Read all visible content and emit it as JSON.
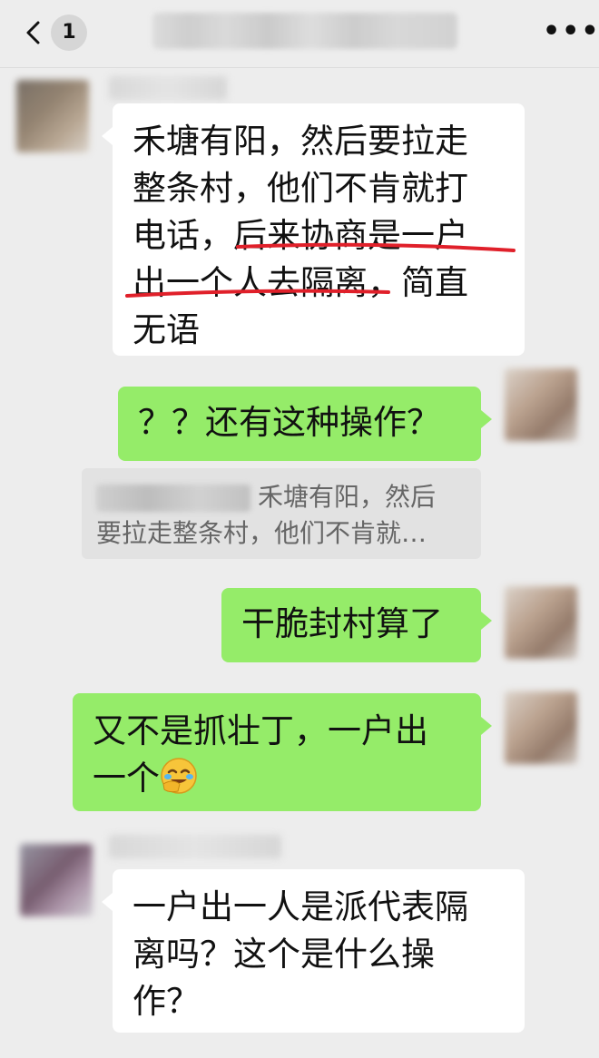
{
  "header": {
    "back_icon": "chevron-left-icon",
    "unread_count": "1",
    "more_icon": "more-dots-icon",
    "more_glyph": "•••"
  },
  "messages": [
    {
      "side": "left",
      "text_lines": [
        "禾塘有阳，然后要拉走",
        "整条村，他们不肯就打",
        "电话，后来协商是一户",
        "出一个人去隔离，简直",
        "无语"
      ]
    },
    {
      "side": "right",
      "text": "？？还有这种操作？"
    },
    {
      "side": "quote",
      "quote_text_line1": "禾塘有阳，然后",
      "quote_text_line2": "要拉走整条村，他们不肯就…"
    },
    {
      "side": "right",
      "text": "干脆封村算了"
    },
    {
      "side": "right",
      "text_line1": "又不是抓壮丁，一户出",
      "text_line2": "一个",
      "emoji": "face-palm-laughing-icon"
    },
    {
      "side": "left",
      "text_lines": [
        "一户出一人是派代表隔",
        "离吗？这个是什么操",
        "作？"
      ]
    }
  ],
  "colors": {
    "background": "#ededed",
    "bubble_self": "#95ec69",
    "bubble_other": "#ffffff",
    "underline": "#e0202a"
  }
}
